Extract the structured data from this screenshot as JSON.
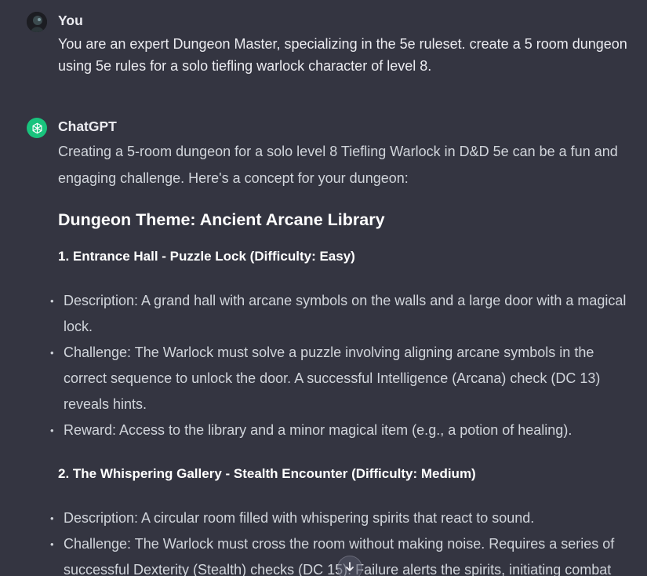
{
  "user_message": {
    "author": "You",
    "text": "You are an expert Dungeon Master, specializing in the 5e ruleset. create a 5 room dungeon using 5e rules for a solo tiefling warlock character of level 8."
  },
  "assistant_message": {
    "author": "ChatGPT",
    "intro": "Creating a 5-room dungeon for a solo level 8 Tiefling Warlock in D&D 5e can be a fun and engaging challenge. Here's a concept for your dungeon:",
    "theme_heading": "Dungeon Theme: Ancient Arcane Library",
    "rooms": [
      {
        "heading": "1. Entrance Hall - Puzzle Lock (Difficulty: Easy)",
        "bullets": [
          "Description: A grand hall with arcane symbols on the walls and a large door with a magical lock.",
          "Challenge: The Warlock must solve a puzzle involving aligning arcane symbols in the correct sequence to unlock the door. A successful Intelligence (Arcana) check (DC 13) reveals hints.",
          "Reward: Access to the library and a minor magical item (e.g., a potion of healing)."
        ]
      },
      {
        "heading": "2. The Whispering Gallery - Stealth Encounter (Difficulty: Medium)",
        "bullets": [
          "Description: A circular room filled with whispering spirits that react to sound.",
          "Challenge: The Warlock must cross the room without making noise. Requires a series of successful Dexterity (Stealth) checks (DC 15). Failure alerts the spirits, initiating combat"
        ]
      }
    ]
  },
  "icons": {
    "user_avatar": "user-avatar-image",
    "assistant_avatar": "openai-logo-icon",
    "scroll": "arrow-down-icon"
  },
  "colors": {
    "background": "#343541",
    "assistant_avatar_bg": "#19c37d",
    "text": "#d1d5db",
    "heading": "#ffffff"
  }
}
